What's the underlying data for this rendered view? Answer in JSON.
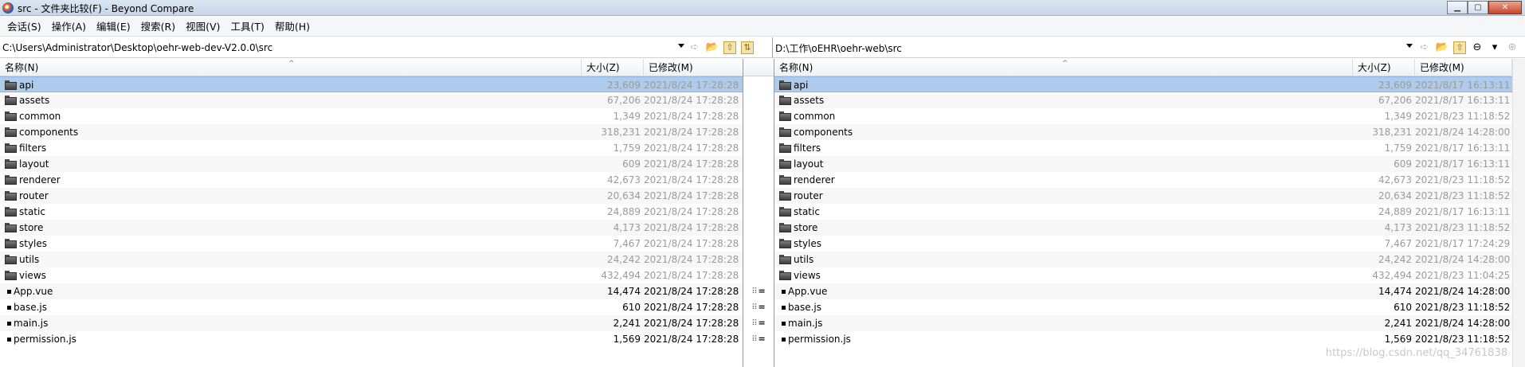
{
  "window": {
    "title": "src - 文件夹比较(F) - Beyond Compare",
    "minimize": "▁",
    "maximize": "▢",
    "close": "✕"
  },
  "menu": [
    "会话(S)",
    "操作(A)",
    "编辑(E)",
    "搜索(R)",
    "视图(V)",
    "工具(T)",
    "帮助(H)"
  ],
  "left": {
    "path": "C:\\Users\\Administrator\\Desktop\\oehr-web-dev-V2.0.0\\src",
    "headers": {
      "name": "名称(N)",
      "size": "大小(Z)",
      "modified": "已修改(M)"
    },
    "rows": [
      {
        "type": "folder",
        "name": "api",
        "size": "23,609",
        "date": "2021/8/24 17:28:28",
        "selected": true
      },
      {
        "type": "folder",
        "name": "assets",
        "size": "67,206",
        "date": "2021/8/24 17:28:28"
      },
      {
        "type": "folder",
        "name": "common",
        "size": "1,349",
        "date": "2021/8/24 17:28:28"
      },
      {
        "type": "folder",
        "name": "components",
        "size": "318,231",
        "date": "2021/8/24 17:28:28"
      },
      {
        "type": "folder",
        "name": "filters",
        "size": "1,759",
        "date": "2021/8/24 17:28:28"
      },
      {
        "type": "folder",
        "name": "layout",
        "size": "609",
        "date": "2021/8/24 17:28:28"
      },
      {
        "type": "folder",
        "name": "renderer",
        "size": "42,673",
        "date": "2021/8/24 17:28:28"
      },
      {
        "type": "folder",
        "name": "router",
        "size": "20,634",
        "date": "2021/8/24 17:28:28"
      },
      {
        "type": "folder",
        "name": "static",
        "size": "24,889",
        "date": "2021/8/24 17:28:28"
      },
      {
        "type": "folder",
        "name": "store",
        "size": "4,173",
        "date": "2021/8/24 17:28:28"
      },
      {
        "type": "folder",
        "name": "styles",
        "size": "7,467",
        "date": "2021/8/24 17:28:28"
      },
      {
        "type": "folder",
        "name": "utils",
        "size": "24,242",
        "date": "2021/8/24 17:28:28"
      },
      {
        "type": "folder",
        "name": "views",
        "size": "432,494",
        "date": "2021/8/24 17:28:28"
      },
      {
        "type": "file",
        "name": "App.vue",
        "size": "14,474",
        "date": "2021/8/24 17:28:28"
      },
      {
        "type": "file",
        "name": "base.js",
        "size": "610",
        "date": "2021/8/24 17:28:28"
      },
      {
        "type": "file",
        "name": "main.js",
        "size": "2,241",
        "date": "2021/8/24 17:28:28"
      },
      {
        "type": "file",
        "name": "permission.js",
        "size": "1,569",
        "date": "2021/8/24 17:28:28"
      }
    ]
  },
  "right": {
    "path": "D:\\工作\\oEHR\\oehr-web\\src",
    "headers": {
      "name": "名称(N)",
      "size": "大小(Z)",
      "modified": "已修改(M)"
    },
    "rows": [
      {
        "type": "folder",
        "name": "api",
        "size": "23,609",
        "date": "2021/8/17 16:13:11",
        "selected": true
      },
      {
        "type": "folder",
        "name": "assets",
        "size": "67,206",
        "date": "2021/8/17 16:13:11"
      },
      {
        "type": "folder",
        "name": "common",
        "size": "1,349",
        "date": "2021/8/23 11:18:52"
      },
      {
        "type": "folder",
        "name": "components",
        "size": "318,231",
        "date": "2021/8/24 14:28:00"
      },
      {
        "type": "folder",
        "name": "filters",
        "size": "1,759",
        "date": "2021/8/17 16:13:11"
      },
      {
        "type": "folder",
        "name": "layout",
        "size": "609",
        "date": "2021/8/17 16:13:11"
      },
      {
        "type": "folder",
        "name": "renderer",
        "size": "42,673",
        "date": "2021/8/23 11:18:52"
      },
      {
        "type": "folder",
        "name": "router",
        "size": "20,634",
        "date": "2021/8/23 11:18:52"
      },
      {
        "type": "folder",
        "name": "static",
        "size": "24,889",
        "date": "2021/8/17 16:13:11"
      },
      {
        "type": "folder",
        "name": "store",
        "size": "4,173",
        "date": "2021/8/23 11:18:52"
      },
      {
        "type": "folder",
        "name": "styles",
        "size": "7,467",
        "date": "2021/8/17 17:24:29"
      },
      {
        "type": "folder",
        "name": "utils",
        "size": "24,242",
        "date": "2021/8/24 14:28:00"
      },
      {
        "type": "folder",
        "name": "views",
        "size": "432,494",
        "date": "2021/8/23 11:04:25"
      },
      {
        "type": "file",
        "name": "App.vue",
        "size": "14,474",
        "date": "2021/8/24 14:28:00"
      },
      {
        "type": "file",
        "name": "base.js",
        "size": "610",
        "date": "2021/8/23 11:18:52"
      },
      {
        "type": "file",
        "name": "main.js",
        "size": "2,241",
        "date": "2021/8/24 14:28:00"
      },
      {
        "type": "file",
        "name": "permission.js",
        "size": "1,569",
        "date": "2021/8/23 11:18:52"
      }
    ]
  },
  "gutter": {
    "equal_marker": "=",
    "sync_marker": "⠿"
  },
  "watermark": "https://blog.csdn.net/qq_34761838",
  "colors": {
    "selection": "#aecbeb",
    "folder_meta": "#9a9a9a"
  }
}
